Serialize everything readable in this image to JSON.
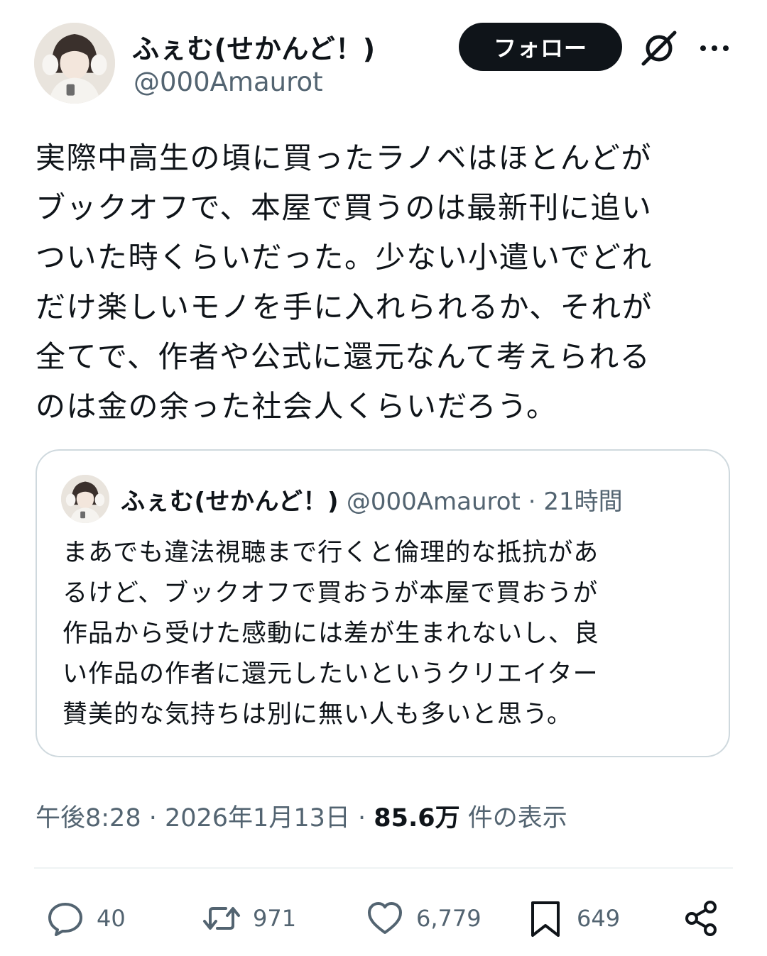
{
  "author": {
    "display_name": "ふぇむ(せかんど！)",
    "handle": "@000Amaurot"
  },
  "header": {
    "follow_label": "フォロー",
    "grok_icon": "grok-icon",
    "more_icon": "more-icon"
  },
  "tweet": {
    "lines": [
      "実際中高生の頃に買ったラノベはほとんどが",
      "ブックオフで、本屋で買うのは最新刊に追い",
      "ついた時くらいだった。少ない小遣いでどれ",
      "だけ楽しいモノを手に入れられるか、それが",
      "全てで、作者や公式に還元なんて考えられる",
      "のは金の余った社会人くらいだろう。"
    ]
  },
  "quote": {
    "display_name": "ふぇむ(せかんど！)",
    "meta": " @000Amaurot · 21時間",
    "lines": [
      "まあでも違法視聴まで行くと倫理的な抵抗があ",
      "るけど、ブックオフで買おうが本屋で買おうが",
      "作品から受けた感動には差が生まれないし、良",
      "い作品の作者に還元したいというクリエイター",
      "賛美的な気持ちは別に無い人も多いと思う。"
    ]
  },
  "timestamp": {
    "time_date": "午後8:28 · 2026年1月13日 · ",
    "views_count": "85.6万",
    "views_label": " 件の表示"
  },
  "actions": {
    "reply": "40",
    "retweet": "971",
    "like": "6,779",
    "bookmark": "649"
  },
  "colors": {
    "text": "#0f1419",
    "secondary": "#536471",
    "border": "#cfd9de",
    "follow_bg": "#0f1419"
  }
}
